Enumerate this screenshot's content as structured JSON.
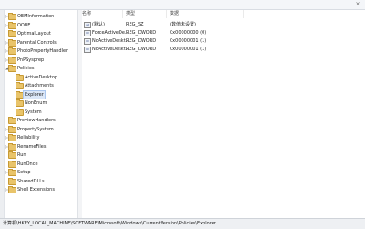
{
  "window": {
    "close_glyph": "×"
  },
  "tree": {
    "items": [
      {
        "label": "OEMInformation",
        "expander": "▷",
        "indent": 0
      },
      {
        "label": "OOBE",
        "expander": "▷",
        "indent": 0
      },
      {
        "label": "OptimalLayout",
        "expander": "",
        "indent": 0
      },
      {
        "label": "Parental Controls",
        "expander": "▷",
        "indent": 0
      },
      {
        "label": "PhotoPropertyHandler",
        "expander": "▷",
        "indent": 0
      },
      {
        "label": "PnPSysprep",
        "expander": "▷",
        "indent": 0
      },
      {
        "label": "Policies",
        "expander": "◢",
        "indent": 0
      },
      {
        "label": "ActiveDesktop",
        "expander": "",
        "indent": 1
      },
      {
        "label": "Attachments",
        "expander": "",
        "indent": 1
      },
      {
        "label": "Explorer",
        "expander": "",
        "indent": 1,
        "selected": true
      },
      {
        "label": "NonEnum",
        "expander": "",
        "indent": 1
      },
      {
        "label": "System",
        "expander": "",
        "indent": 1
      },
      {
        "label": "PreviewHandlers",
        "expander": "",
        "indent": 0
      },
      {
        "label": "PropertySystem",
        "expander": "▷",
        "indent": 0
      },
      {
        "label": "Reliability",
        "expander": "▷",
        "indent": 0
      },
      {
        "label": "RenameFiles",
        "expander": "▷",
        "indent": 0
      },
      {
        "label": "Run",
        "expander": "",
        "indent": 0
      },
      {
        "label": "RunOnce",
        "expander": "",
        "indent": 0
      },
      {
        "label": "Setup",
        "expander": "▷",
        "indent": 0
      },
      {
        "label": "SharedDLLs",
        "expander": "",
        "indent": 0
      },
      {
        "label": "Shell Extensions",
        "expander": "▷",
        "indent": 0
      }
    ]
  },
  "values_pane": {
    "columns": {
      "name": "名称",
      "type": "类型",
      "data": "数据"
    },
    "rows": [
      {
        "icon": "ab",
        "name": "(默认)",
        "type": "REG_SZ",
        "data": "(数值未设置)"
      },
      {
        "icon": "01",
        "name": "ForceActiveDe...",
        "type": "REG_DWORD",
        "data": "0x00000000 (0)"
      },
      {
        "icon": "01",
        "name": "NoActiveDeskt...",
        "type": "REG_DWORD",
        "data": "0x00000001 (1)"
      },
      {
        "icon": "01",
        "name": "NoActiveDeskt...",
        "type": "REG_DWORD",
        "data": "0x00000001 (1)"
      }
    ]
  },
  "statusbar": {
    "path": "计算机\\HKEY_LOCAL_MACHINE\\SOFTWARE\\Microsoft\\Windows\\CurrentVersion\\Policies\\Explorer"
  }
}
